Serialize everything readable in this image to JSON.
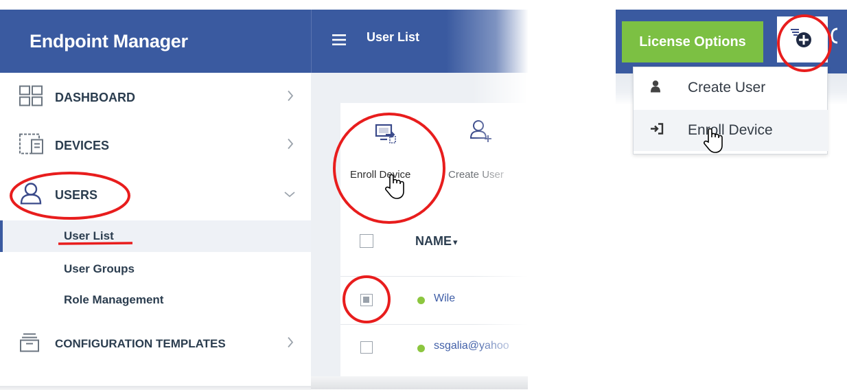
{
  "sidebar": {
    "title": "Endpoint Manager",
    "items": [
      {
        "label": "DASHBOARD",
        "icon": "dashboard-grid-icon"
      },
      {
        "label": "DEVICES",
        "icon": "devices-icon"
      },
      {
        "label": "USERS",
        "icon": "user-icon"
      },
      {
        "label": "CONFIGURATION TEMPLATES",
        "icon": "templates-icon"
      }
    ],
    "subitems": [
      {
        "label": "User List",
        "active": true
      },
      {
        "label": "User Groups"
      },
      {
        "label": "Role Management"
      }
    ]
  },
  "main": {
    "title": "User List",
    "toolbar": {
      "enroll_device": "Enroll Device",
      "create_user": "Create User"
    },
    "table": {
      "name_header": "NAME",
      "sort_glyph": "▾",
      "rows": [
        {
          "name": "Wile",
          "status_color": "#8cc63f",
          "checked": true
        },
        {
          "name": "ssgalia@yahoo",
          "status_color": "#8cc63f",
          "checked": false
        }
      ]
    }
  },
  "header_right": {
    "license_button": "License Options",
    "add_menu": {
      "icon": "add-plus-icon",
      "items": [
        {
          "label": "Create User",
          "icon": "user-silhouette-icon"
        },
        {
          "label": "Enroll Device",
          "icon": "sign-in-icon"
        }
      ]
    }
  },
  "colors": {
    "header_blue": "#3a5aa0",
    "license_green": "#7cc043",
    "annotation_red": "#e81d1d",
    "link_blue": "#3f5ea7"
  }
}
